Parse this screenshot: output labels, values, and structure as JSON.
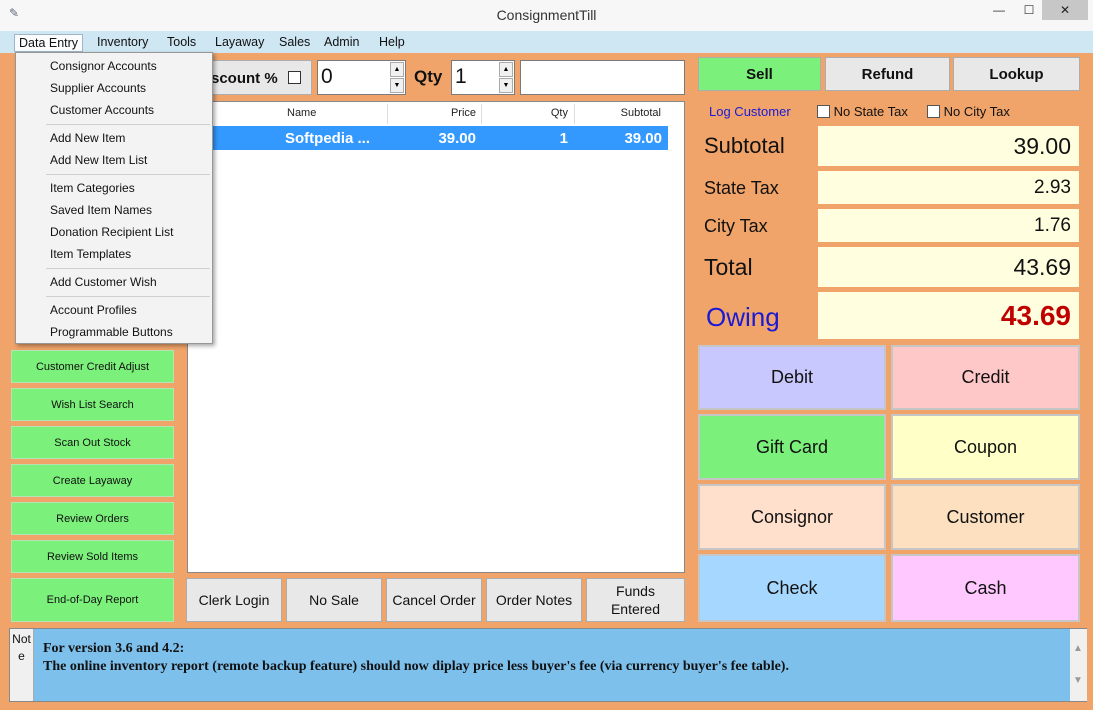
{
  "window": {
    "title": "ConsignmentTill",
    "minimize": "—",
    "maximize": "☐",
    "close": "✕"
  },
  "menubar": [
    "Data Entry",
    "Inventory",
    "Tools",
    "Layaway",
    "Sales",
    "Admin",
    "Help"
  ],
  "dropdown": {
    "groups": [
      [
        "Consignor Accounts",
        "Supplier Accounts",
        "Customer Accounts"
      ],
      [
        "Add New Item",
        "Add New Item List"
      ],
      [
        "Item Categories",
        "Saved Item Names",
        "Donation Recipient List",
        "Item Templates"
      ],
      [
        "Add Customer Wish"
      ],
      [
        "Account Profiles",
        "Programmable Buttons"
      ]
    ]
  },
  "left_buttons": [
    "Customer Credit Adjust",
    "Wish List Search",
    "Scan Out Stock",
    "Create Layaway",
    "Review Orders",
    "Review Sold Items",
    "End-of-Day Report"
  ],
  "entry": {
    "discount_label": "scount %",
    "discount_value": "0",
    "qty_label": "Qty",
    "qty_value": "1",
    "barcode_value": ""
  },
  "grid": {
    "columns": [
      "Name",
      "Price",
      "Qty",
      "Subtotal"
    ],
    "rows": [
      {
        "name": "Softpedia ...",
        "price": "39.00",
        "qty": "1",
        "subtotal": "39.00"
      }
    ]
  },
  "center_buttons": [
    "Clerk Login",
    "No Sale",
    "Cancel Order",
    "Order Notes",
    "Funds Entered"
  ],
  "tabs": [
    "Sell",
    "Refund",
    "Lookup"
  ],
  "options": {
    "log_customer": "Log Customer",
    "no_state_tax": "No State Tax",
    "no_city_tax": "No City Tax"
  },
  "totals": {
    "subtotal_label": "Subtotal",
    "subtotal": "39.00",
    "state_tax_label": "State Tax",
    "state_tax": "2.93",
    "city_tax_label": "City Tax",
    "city_tax": "1.76",
    "total_label": "Total",
    "total": "43.69",
    "owing_label": "Owing",
    "owing": "43.69"
  },
  "payments": [
    "Debit",
    "Credit",
    "Gift Card",
    "Coupon",
    "Consignor",
    "Customer",
    "Check",
    "Cash"
  ],
  "note": {
    "tab": "Note",
    "line1": "For version 3.6 and 4.2:",
    "line2": "The online inventory report (remote backup feature) should now diplay price less buyer's fee (via currency buyer's fee table)."
  },
  "colors": {
    "accent_orange": "#f28a4c",
    "sell_green": "#7bf07b",
    "row_blue": "#3399ff",
    "owing_label": "#1a1ad6",
    "owing_value": "#c00000",
    "totals_bg": "#ffffe0"
  }
}
